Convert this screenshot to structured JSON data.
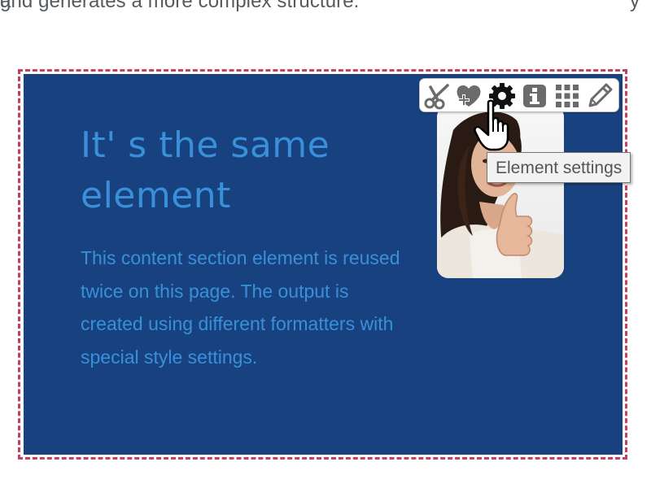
{
  "intro": {
    "line_top_fragment_a": "g",
    "line_top_fragment_b": "y",
    "line_2": "and generates a more complex structure."
  },
  "section": {
    "headline": "It' s  the same element",
    "body": "This content section element is reused twice on this page. The output is created using different formatters with special style settings."
  },
  "toolbar": {
    "buttons": [
      {
        "icon": "scissors-icon",
        "label": "Cut"
      },
      {
        "icon": "heart-add-icon",
        "label": "Add to favorites"
      },
      {
        "icon": "gear-icon",
        "label": "Element settings"
      },
      {
        "icon": "info-icon",
        "label": "Info"
      },
      {
        "icon": "grid-icon",
        "label": "Move"
      },
      {
        "icon": "pencil-icon",
        "label": "Edit"
      }
    ]
  },
  "tooltip": {
    "text": "Element settings"
  },
  "colors": {
    "panel_bg": "#17427f",
    "panel_text": "#3a8fd9",
    "dashed_border": "#c4405f",
    "intro_text": "#555a5e"
  }
}
